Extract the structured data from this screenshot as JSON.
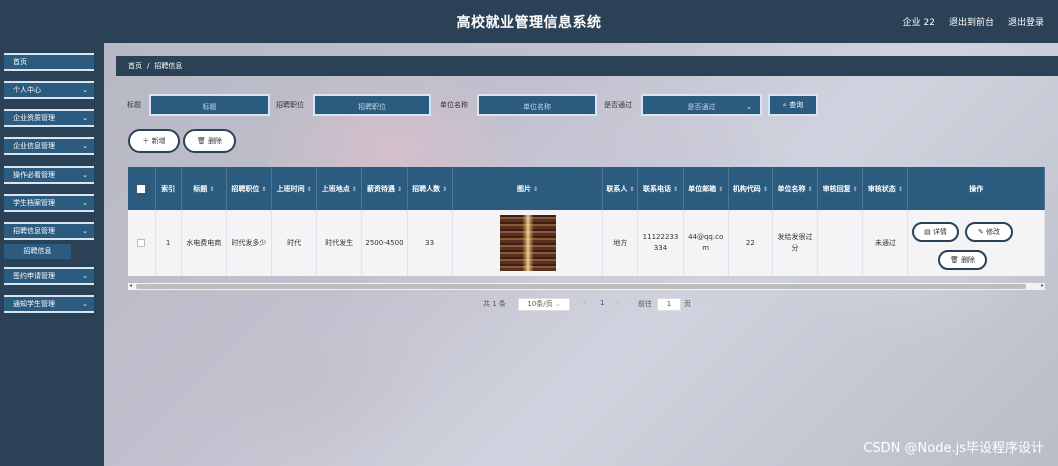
{
  "header": {
    "title": "高校就业管理信息系统",
    "user": "企业 22",
    "back_to_front": "退出到前台",
    "logout": "退出登录"
  },
  "sidebar": {
    "items": [
      {
        "label": "首页",
        "chevron": ""
      },
      {
        "label": "个人中心",
        "chevron": "⌄"
      },
      {
        "label": "企业资质管理",
        "chevron": "⌄"
      },
      {
        "label": "企业信息管理",
        "chevron": "⌄"
      },
      {
        "label": "操作必看管理",
        "chevron": "⌄"
      },
      {
        "label": "学生档案管理",
        "chevron": "⌄"
      },
      {
        "label": "招聘信息管理",
        "chevron": "⌄"
      },
      {
        "label": "签约申请管理",
        "chevron": "⌄"
      },
      {
        "label": "通知学生管理",
        "chevron": "⌄"
      }
    ],
    "sub_item": "招聘信息"
  },
  "breadcrumb": {
    "home": "首页",
    "separator": "/",
    "current": "招聘信息"
  },
  "search": {
    "title_label": "标题",
    "title_placeholder": "标题",
    "position_label": "招聘职位",
    "position_placeholder": "招聘职位",
    "company_label": "单位名称",
    "company_placeholder": "单位名称",
    "passed_label": "是否通过",
    "passed_placeholder": "是否通过",
    "query_button": "查询"
  },
  "actions": {
    "add": "新增",
    "delete": "删除"
  },
  "table": {
    "headers": [
      "索引",
      "标题",
      "招聘职位",
      "上班时间",
      "上班地点",
      "薪资待遇",
      "招聘人数",
      "图片",
      "联系人",
      "联系电话",
      "单位邮箱",
      "机构代码",
      "单位名称",
      "审核回复",
      "审核状态",
      "操作"
    ],
    "rows": [
      {
        "index": "1",
        "title": "水电费电商",
        "position": "时代发多少",
        "work_time": "时代",
        "work_place": "时代发生",
        "salary": "2500-4500",
        "headcount": "33",
        "contact": "地方",
        "phone": "11122233334",
        "email": "44@qq.com",
        "org_code": "22",
        "company": "发给发很过分",
        "reply": "",
        "status": "未通过",
        "ops": {
          "detail": "详情",
          "edit": "修改",
          "delete": "删除"
        }
      }
    ]
  },
  "pagination": {
    "total": "共 1 条",
    "page_size": "10条/页",
    "current_page": "1",
    "goto_label": "前往",
    "goto_value": "1",
    "page_suffix": "页"
  },
  "watermark": "CSDN @Node.js毕设程序设计",
  "colors": {
    "primary": "#2c5b80",
    "header": "#2b4256"
  }
}
